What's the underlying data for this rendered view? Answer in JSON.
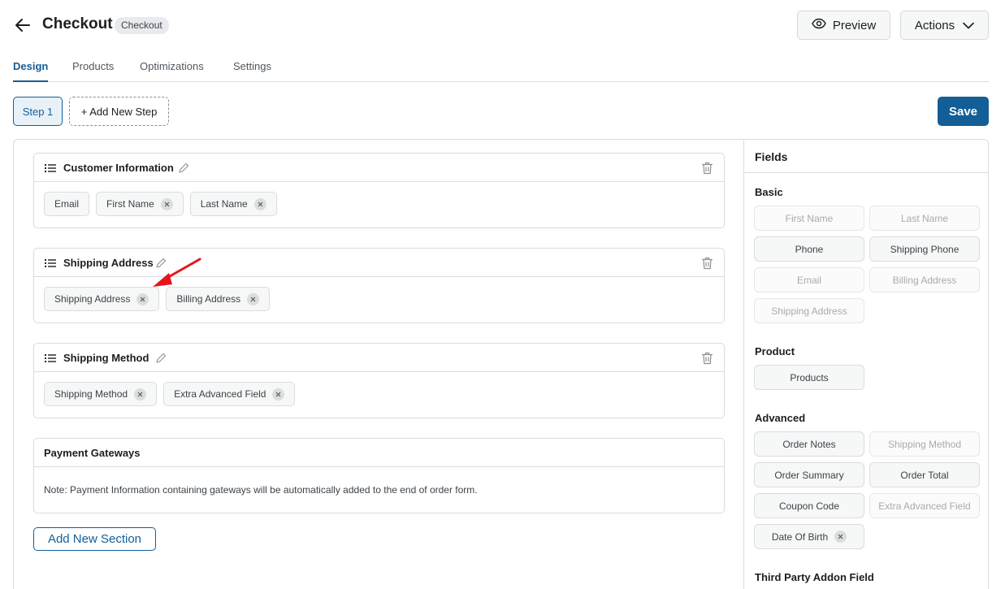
{
  "header": {
    "title": "Checkout",
    "badge": "Checkout",
    "preview_label": "Preview",
    "actions_label": "Actions"
  },
  "tabs": [
    {
      "label": "Design",
      "active": true
    },
    {
      "label": "Products",
      "active": false
    },
    {
      "label": "Optimizations",
      "active": false
    },
    {
      "label": "Settings",
      "active": false
    }
  ],
  "steps": {
    "step1_label": "Step 1",
    "add_step_label": "+ Add New Step",
    "save_label": "Save"
  },
  "sections": [
    {
      "title": "Customer Information",
      "fields": [
        {
          "label": "Email",
          "removable": false
        },
        {
          "label": "First Name",
          "removable": true
        },
        {
          "label": "Last Name",
          "removable": true
        }
      ]
    },
    {
      "title": "Shipping Address",
      "fields": [
        {
          "label": "Shipping Address",
          "removable": true
        },
        {
          "label": "Billing Address",
          "removable": true
        }
      ]
    },
    {
      "title": "Shipping Method",
      "fields": [
        {
          "label": "Shipping Method",
          "removable": true
        },
        {
          "label": "Extra Advanced Field",
          "removable": true
        }
      ]
    }
  ],
  "payment": {
    "title": "Payment Gateways",
    "note": "Note: Payment Information containing gateways will be automatically added to the end of order form."
  },
  "add_section_label": "Add New Section",
  "fields_panel": {
    "title": "Fields",
    "groups": [
      {
        "title": "Basic",
        "items": [
          {
            "label": "First Name",
            "disabled": true
          },
          {
            "label": "Last Name",
            "disabled": true
          },
          {
            "label": "Phone",
            "disabled": false
          },
          {
            "label": "Shipping Phone",
            "disabled": false
          },
          {
            "label": "Email",
            "disabled": true
          },
          {
            "label": "Billing Address",
            "disabled": true
          },
          {
            "label": "Shipping Address",
            "disabled": true
          }
        ]
      },
      {
        "title": "Product",
        "items": [
          {
            "label": "Products",
            "disabled": false
          }
        ]
      },
      {
        "title": "Advanced",
        "items": [
          {
            "label": "Order Notes",
            "disabled": false
          },
          {
            "label": "Shipping Method",
            "disabled": true
          },
          {
            "label": "Order Summary",
            "disabled": false
          },
          {
            "label": "Order Total",
            "disabled": false
          },
          {
            "label": "Coupon Code",
            "disabled": false
          },
          {
            "label": "Extra Advanced Field",
            "disabled": true
          },
          {
            "label": "Date Of Birth",
            "disabled": false
          }
        ]
      },
      {
        "title": "Third Party Addon Field",
        "items": []
      }
    ]
  },
  "colors": {
    "primary": "#135e96",
    "annotation_arrow": "#e8141c"
  }
}
